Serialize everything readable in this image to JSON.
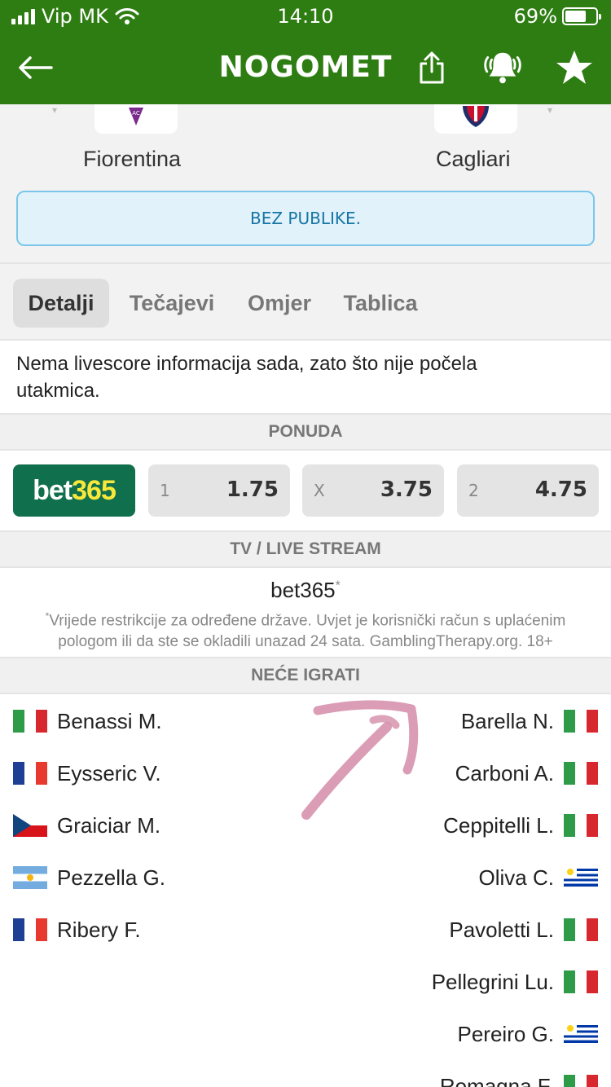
{
  "status_bar": {
    "carrier": "Vip MK",
    "time": "14:10",
    "battery": "69%",
    "battery_level": 0.69
  },
  "header": {
    "title": "NOGOMET",
    "back_icon": "arrow-left-icon",
    "share_icon": "share-icon",
    "alert_icon": "bell-ringing-icon",
    "favorite_icon": "star-icon"
  },
  "match": {
    "home_team": "Fiorentina",
    "away_team": "Cagliari",
    "notice": "BEZ PUBLIKE."
  },
  "tabs": [
    {
      "label": "Detalji",
      "active": true
    },
    {
      "label": "Tečajevi",
      "active": false
    },
    {
      "label": "Omjer",
      "active": false
    },
    {
      "label": "Tablica",
      "active": false
    }
  ],
  "info_text": "Nema livescore informacija sada, zato što nije počela utakmica.",
  "offer": {
    "section_title": "PONUDA",
    "bookmaker_part1": "bet",
    "bookmaker_part2": "365",
    "odds": [
      {
        "label": "1",
        "value": "1.75"
      },
      {
        "label": "X",
        "value": "3.75"
      },
      {
        "label": "2",
        "value": "4.75"
      }
    ]
  },
  "tv": {
    "section_title": "TV / LIVE STREAM",
    "channel": "bet365",
    "asterisk": "*",
    "disclaimer": "Vrijede restrikcije za određene države. Uvjet je korisnički račun s uplaćenim pologom ili da ste se okladili unazad 24 sata. GamblingTherapy.org. 18+"
  },
  "missing": {
    "section_title": "NEĆE IGRATI",
    "home": [
      {
        "name": "Benassi M.",
        "flag": "italy"
      },
      {
        "name": "Eysseric V.",
        "flag": "france"
      },
      {
        "name": "Graiciar M.",
        "flag": "czech-republic"
      },
      {
        "name": "Pezzella G.",
        "flag": "argentina"
      },
      {
        "name": "Ribery F.",
        "flag": "france"
      }
    ],
    "away": [
      {
        "name": "Barella N.",
        "flag": "italy"
      },
      {
        "name": "Carboni A.",
        "flag": "italy"
      },
      {
        "name": "Ceppitelli L.",
        "flag": "italy"
      },
      {
        "name": "Oliva C.",
        "flag": "uruguay"
      },
      {
        "name": "Pavoletti L.",
        "flag": "italy"
      },
      {
        "name": "Pellegrini Lu.",
        "flag": "italy"
      },
      {
        "name": "Pereiro G.",
        "flag": "uruguay"
      },
      {
        "name": "Romagna F.",
        "flag": "italy"
      }
    ]
  },
  "colors": {
    "header_green": "#2e7d12",
    "bet365_green": "#106f4c",
    "bet365_yellow": "#f8e83a",
    "notice_bg": "#e1f2fb",
    "notice_border": "#7cc6ea",
    "annotation_pink": "#d48ca8"
  }
}
